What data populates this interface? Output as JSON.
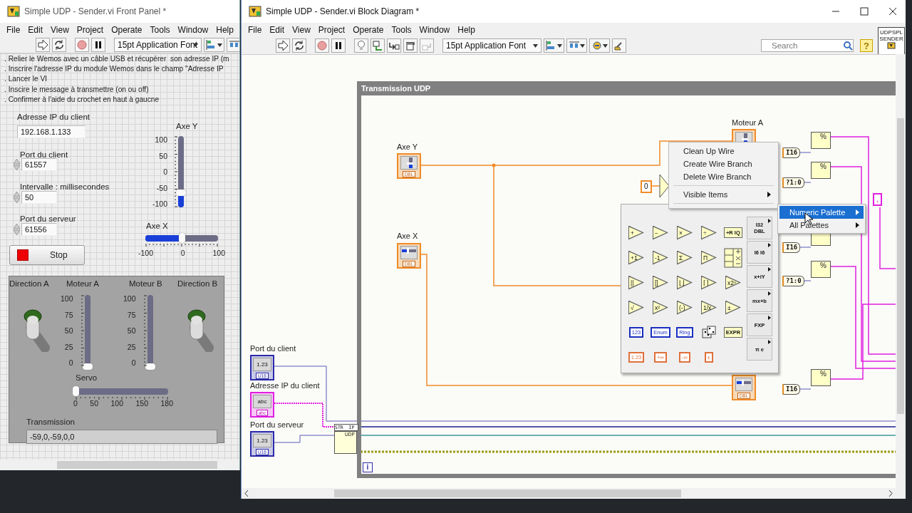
{
  "front_panel": {
    "title": "Simple UDP - Sender.vi Front Panel *",
    "menu": [
      "File",
      "Edit",
      "View",
      "Project",
      "Operate",
      "Tools",
      "Window",
      "Help"
    ],
    "font_selector": "15pt Application Font",
    "instructions": [
      ". Relier le Wemos avec un câble USB et récupérer  son adresse IP (m",
      ". Inscrire l'adresse IP du module Wemos dans le champ \"Adresse IP",
      ". Lancer le VI",
      ". Inscire le message à transmettre (on ou off)",
      ". Confirmer à l'aide du crochet en haut à gaucne"
    ],
    "controls": [
      {
        "kind": "string",
        "label": "Adresse IP du client",
        "value": "192.168.1.133"
      },
      {
        "kind": "numeric",
        "label": "Port du client",
        "value": "61557"
      },
      {
        "kind": "numeric",
        "label": "Intervalle : millisecondes",
        "value": "50"
      },
      {
        "kind": "numeric",
        "label": "Port du serveur",
        "value": "61556"
      }
    ],
    "stop_button": {
      "label": "Stop"
    },
    "sliders": [
      {
        "label": "Axe Y",
        "kind": "vslider",
        "ticks": [
          "100",
          "50",
          "0",
          "-50",
          "-100"
        ],
        "level": 0.205
      },
      {
        "label": "Axe X",
        "kind": "hslider",
        "ticks": [
          "-100",
          "0",
          "100"
        ],
        "level": 0.5
      }
    ],
    "cluster": {
      "toggles": [
        {
          "label": "Direction A",
          "on": false
        },
        {
          "label": "Direction B",
          "on": false
        }
      ],
      "sliders": [
        {
          "label": "Moteur A",
          "kind": "vslider",
          "ticks": [
            "100",
            "75",
            "50",
            "25",
            "0"
          ],
          "level": 0
        },
        {
          "label": "Moteur B",
          "kind": "vslider",
          "ticks": [
            "100",
            "75",
            "50",
            "25",
            "0"
          ],
          "level": 0
        },
        {
          "label": "Servo",
          "kind": "hslider",
          "ticks": [
            "0",
            "50",
            "100",
            "150",
            "180"
          ],
          "level": 0
        }
      ],
      "indicator": {
        "label": "Transmission",
        "value": "-59,0,-59,0,0"
      }
    }
  },
  "block_diagram": {
    "title": "Simple UDP - Sender.vi Block Diagram *",
    "menu": [
      "File",
      "Edit",
      "View",
      "Project",
      "Operate",
      "Tools",
      "Window",
      "Help"
    ],
    "font_selector": "15pt Application Font",
    "search": {
      "placeholder": "Search"
    },
    "help_button": "?",
    "vi_icon_text": [
      "UDPSPL",
      "SENDER"
    ],
    "frame": {
      "title": "Transmission UDP"
    },
    "terminals": [
      {
        "label": "Axe Y",
        "kind": "vslider",
        "type": "DBL"
      },
      {
        "label": "Axe X",
        "kind": "hslider",
        "type": "DBL"
      },
      {
        "label": "Moteur A",
        "kind": "vslider"
      },
      {
        "kind": "hslider",
        "type": "DBL"
      },
      {
        "label": "Port du client",
        "kind": "numeric",
        "glyph": "1.23",
        "type": "U16"
      },
      {
        "label": "Adresse IP du client",
        "kind": "string",
        "glyph": "abc",
        "type": "abc"
      },
      {
        "label": "Port du serveur",
        "kind": "numeric",
        "glyph": "1.23",
        "type": "U16"
      }
    ],
    "conversions": [
      {
        "text": "I16"
      },
      {
        "text": "?1:0"
      },
      {
        "text": "I16"
      },
      {
        "text": "?1:0"
      },
      {
        "text": "I16"
      }
    ],
    "format_nodes": [
      {
        "kind": "format",
        "glyph": "%"
      },
      {
        "kind": "format",
        "glyph": "%"
      },
      {
        "kind": "format"
      },
      {
        "kind": "format",
        "glyph": "%"
      },
      {
        "kind": "format",
        "glyph": "%"
      }
    ],
    "constants": [
      {
        "kind": "numeric",
        "text": "0"
      },
      {
        "kind": "string",
        "text": ","
      }
    ],
    "udp_nodes": {
      "str_ip": "STR  IP",
      "open": "UDP"
    },
    "loop_index": "i",
    "context_menu": {
      "items": [
        {
          "label": "Clean Up Wire",
          "kind": "item"
        },
        {
          "label": "Create Wire Branch",
          "kind": "item"
        },
        {
          "label": "Delete Wire Branch",
          "kind": "item"
        },
        {
          "label": "Visible Items",
          "kind": "submenu"
        }
      ]
    },
    "palette_menu": {
      "items": [
        {
          "label": "Numeric Palette",
          "selected": true
        },
        {
          "label": "All Palettes",
          "selected": false
        }
      ]
    },
    "numeric_palette": {
      "functions": [
        {
          "kind": "triangle",
          "glyph": "+"
        },
        {
          "kind": "triangle",
          "glyph": "−"
        },
        {
          "kind": "triangle",
          "glyph": "×"
        },
        {
          "kind": "triangle",
          "glyph": "÷"
        },
        {
          "kind": "box",
          "glyph": "÷R IQ"
        },
        {
          "kind": "triangle",
          "glyph": "+1"
        },
        {
          "kind": "triangle",
          "glyph": "-1"
        },
        {
          "kind": "triangle",
          "glyph": "Σ"
        },
        {
          "kind": "triangle",
          "glyph": "Π"
        },
        {
          "kind": "compound"
        },
        {
          "kind": "triangle",
          "glyph": "||"
        },
        {
          "kind": "triangle",
          "glyph": "[]"
        },
        {
          "kind": "triangle",
          "glyph": "⌊⌋"
        },
        {
          "kind": "triangle",
          "glyph": "⌈⌉"
        },
        {
          "kind": "triangle",
          "glyph": "x2ⁿ"
        },
        {
          "kind": "triangle",
          "glyph": "√"
        },
        {
          "kind": "triangle",
          "glyph": "x²"
        },
        {
          "kind": "triangle",
          "glyph": "(-)"
        },
        {
          "kind": "triangle",
          "glyph": "1/x"
        },
        {
          "kind": "triangle",
          "glyph": "±"
        },
        {
          "kind": "const",
          "glyph": "123",
          "color": "#1a2fc0"
        },
        {
          "kind": "const",
          "glyph": "Enum",
          "color": "#1a2fc0"
        },
        {
          "kind": "const",
          "glyph": "Ring",
          "color": "#1a2fc0"
        },
        {
          "kind": "dice"
        },
        {
          "kind": "box",
          "glyph": "EXPR"
        },
        {
          "kind": "const",
          "glyph": "1.23",
          "color": "#e0703a"
        },
        {
          "kind": "const",
          "glyph": "+∞",
          "color": "#e0703a"
        },
        {
          "kind": "const",
          "glyph": "-∞",
          "color": "#e0703a"
        },
        {
          "kind": "const",
          "glyph": "ε",
          "color": "#e0703a"
        }
      ],
      "subpalettes": [
        {
          "text": "I32\nDBL"
        },
        {
          "text": "I6  I6"
        },
        {
          "text": "x+iY"
        },
        {
          "text": "mx+b"
        },
        {
          "text": "FXP"
        },
        {
          "text": "π e"
        }
      ]
    }
  }
}
